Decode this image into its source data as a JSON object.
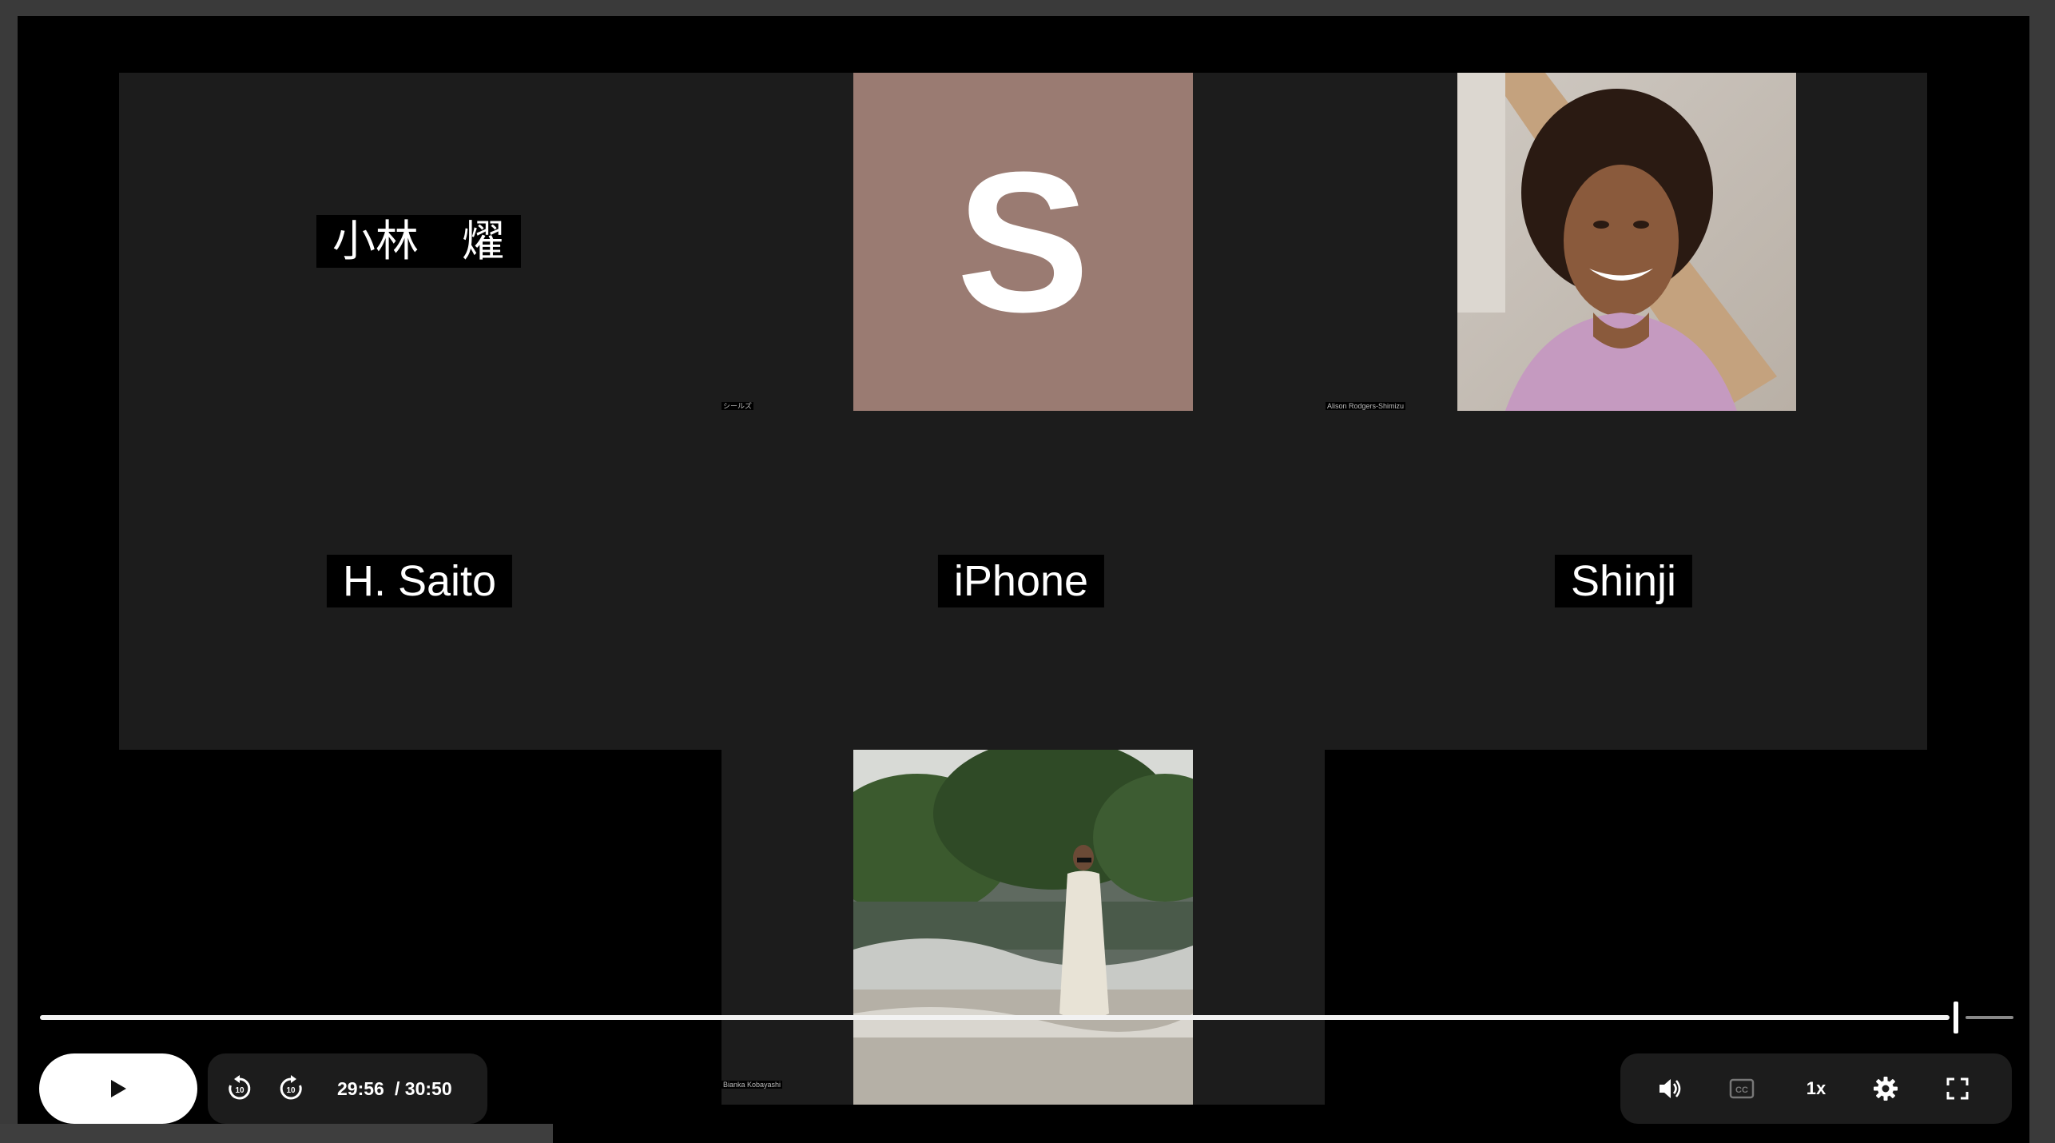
{
  "participants": {
    "kobayashi": {
      "name": "小林　燿"
    },
    "s_tile": {
      "initial": "S",
      "caption": "シールズ"
    },
    "alison": {
      "caption": "Alison Rodgers-Shimizu"
    },
    "saito": {
      "name": "H. Saito"
    },
    "iphone": {
      "name": "iPhone"
    },
    "shinji": {
      "name": "Shinji"
    },
    "bianka": {
      "caption": "Bianka Kobayashi"
    }
  },
  "controls": {
    "current_time": "29:56",
    "total_time": "/ 30:50",
    "speed": "1x",
    "progress": 0.971
  },
  "colors": {
    "avatar_s": "#9a7b72",
    "tile_bg": "#1c1c1c",
    "progress": "#f2f2f2"
  },
  "icons": [
    "play-icon",
    "rewind-10-icon",
    "forward-10-icon",
    "volume-icon",
    "captions-icon",
    "settings-gear-icon",
    "fullscreen-icon"
  ]
}
